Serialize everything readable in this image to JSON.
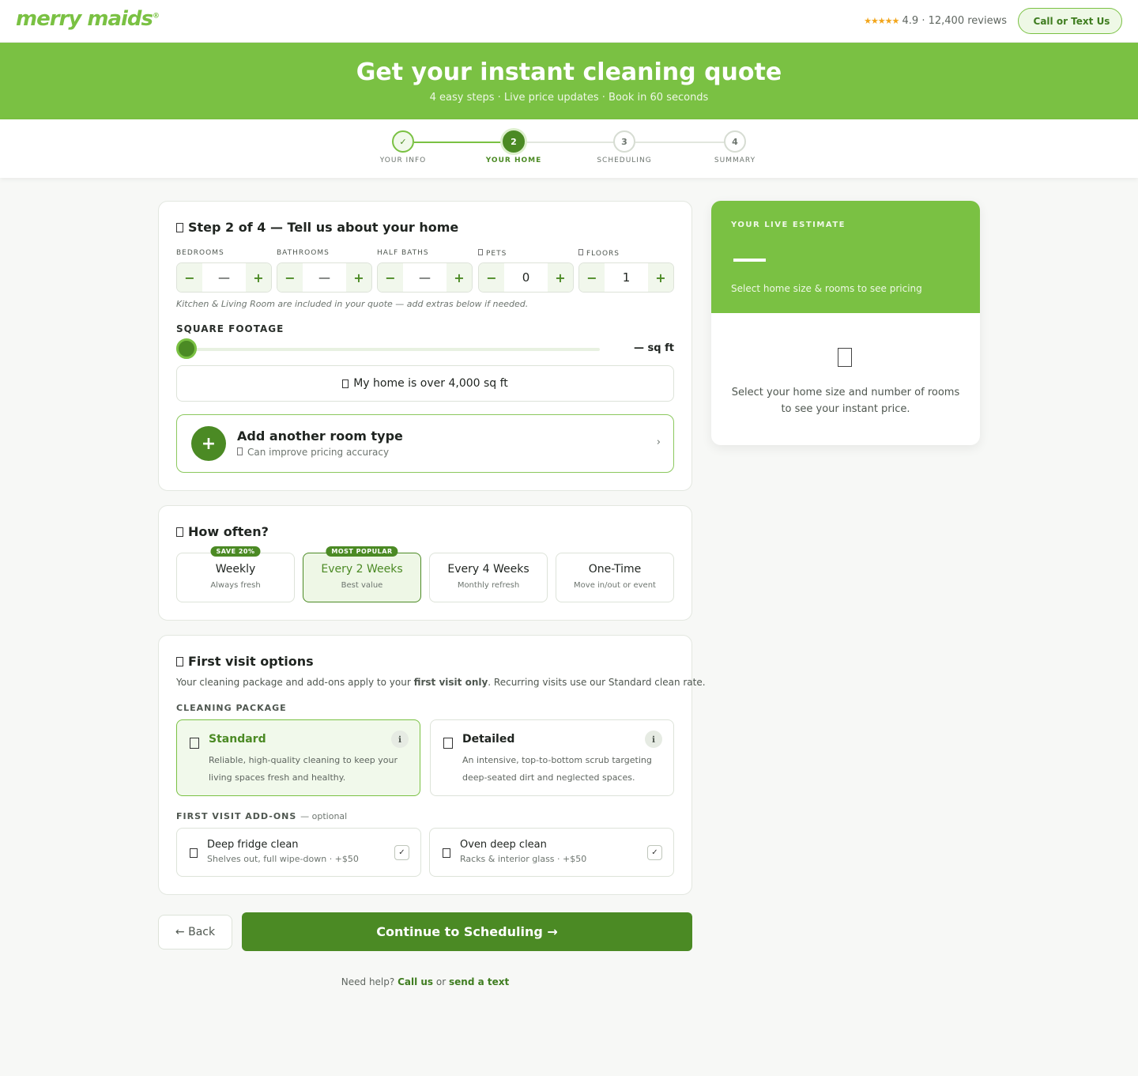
{
  "header": {
    "logo": "merry maids",
    "logo_mark": "®",
    "stars": "★★★★★",
    "rating": "4.9 · 12,400 reviews",
    "call_icon": "",
    "call_label": "Call or Text Us"
  },
  "hero": {
    "title": "Get your instant cleaning quote",
    "subtitle": "4 easy steps · Live price updates · Book in 60 seconds"
  },
  "stepper": {
    "steps": [
      {
        "marker": "✓",
        "label": "YOUR INFO"
      },
      {
        "marker": "2",
        "label": "YOUR HOME"
      },
      {
        "marker": "3",
        "label": "SCHEDULING"
      },
      {
        "marker": "4",
        "label": "SUMMARY"
      }
    ]
  },
  "home": {
    "title": "Step 2 of 4 — Tell us about your home",
    "counters": [
      {
        "label": "BEDROOMS",
        "value": "—"
      },
      {
        "label": "BATHROOMS",
        "value": "—"
      },
      {
        "label": "HALF BATHS",
        "value": "—"
      },
      {
        "label": "PETS",
        "value": "0"
      },
      {
        "label": "FLOORS",
        "value": "1"
      }
    ],
    "minus": "−",
    "plus": "+",
    "note": "Kitchen & Living Room are included in your quote — add extras below if needed.",
    "sqft_label": "SQUARE FOOTAGE",
    "sqft_value": "— sq ft",
    "over_label": "My home is over 4,000 sq ft",
    "add_room_plus": "+",
    "add_room_title": "Add another room type",
    "add_room_sub": "Can improve pricing accuracy",
    "add_room_chevron": "›"
  },
  "frequency": {
    "title": "How often?",
    "options": [
      {
        "badge": "SAVE 20%",
        "title": "Weekly",
        "sub": "Always fresh"
      },
      {
        "badge": "MOST POPULAR",
        "title": "Every 2 Weeks",
        "sub": "Best value"
      },
      {
        "title": "Every 4 Weeks",
        "sub": "Monthly refresh"
      },
      {
        "title": "One-Time",
        "sub": "Move in/out or event"
      }
    ]
  },
  "first_visit": {
    "title": "First visit options",
    "desc_pre": "Your cleaning package and add-ons apply to your ",
    "desc_bold": "first visit only",
    "desc_post": ". Recurring visits use our Standard clean rate.",
    "package_label": "CLEANING PACKAGE",
    "packages": [
      {
        "title": "Standard",
        "desc": "Reliable, high-quality cleaning to keep your living spaces fresh and healthy."
      },
      {
        "title": "Detailed",
        "desc": "An intensive, top-to-bottom scrub targeting deep-seated dirt and neglected spaces."
      }
    ],
    "info_glyph": "ℹ",
    "addons_label": "FIRST VISIT ADD-ONS",
    "addons_optional": "— optional",
    "addons": [
      {
        "title": "Deep fridge clean",
        "sub": "Shelves out, full wipe-down · +$50",
        "check": "✓"
      },
      {
        "title": "Oven deep clean",
        "sub": "Racks & interior glass · +$50",
        "check": "✓"
      }
    ]
  },
  "actions": {
    "back": "← Back",
    "continue": "Continue to Scheduling →",
    "help_pre": "Need help?",
    "help_call": "Call us",
    "help_or": "or",
    "help_text": "send a text"
  },
  "estimate": {
    "label": "YOUR LIVE ESTIMATE",
    "sub": "Select home size & rooms to see pricing",
    "body": "Select your home size and number of rooms to see your instant price."
  }
}
